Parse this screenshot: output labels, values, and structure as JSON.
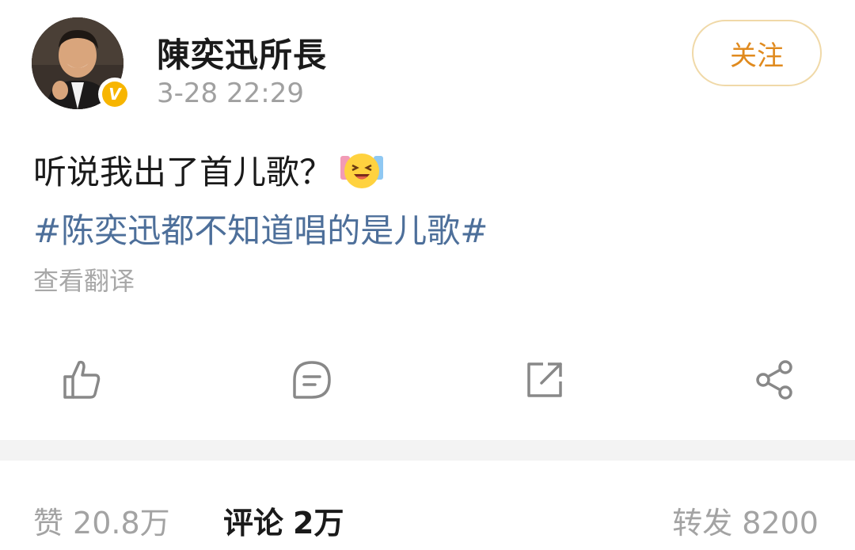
{
  "header": {
    "username": "陳奕迅所長",
    "timestamp": "3-28 22:29",
    "follow_label": "关注",
    "verified_mark": "V"
  },
  "post": {
    "text": "听说我出了首儿歌？",
    "emoji": "laughing-tears-emoji",
    "hashtag": "#陈奕迅都不知道唱的是儿歌#",
    "translate_label": "查看翻译"
  },
  "actions": {
    "icons": [
      "thumbs-up-icon",
      "comment-icon",
      "repost-icon",
      "share-icon"
    ]
  },
  "stats": {
    "likes_label": "赞",
    "likes_value": "20.8万",
    "comments_label": "评论",
    "comments_value": "2万",
    "reposts_label": "转发",
    "reposts_value": "8200"
  },
  "colors": {
    "hashtag": "#4d6f9a",
    "follow": "#e08a1e",
    "verified": "#f7b500"
  }
}
